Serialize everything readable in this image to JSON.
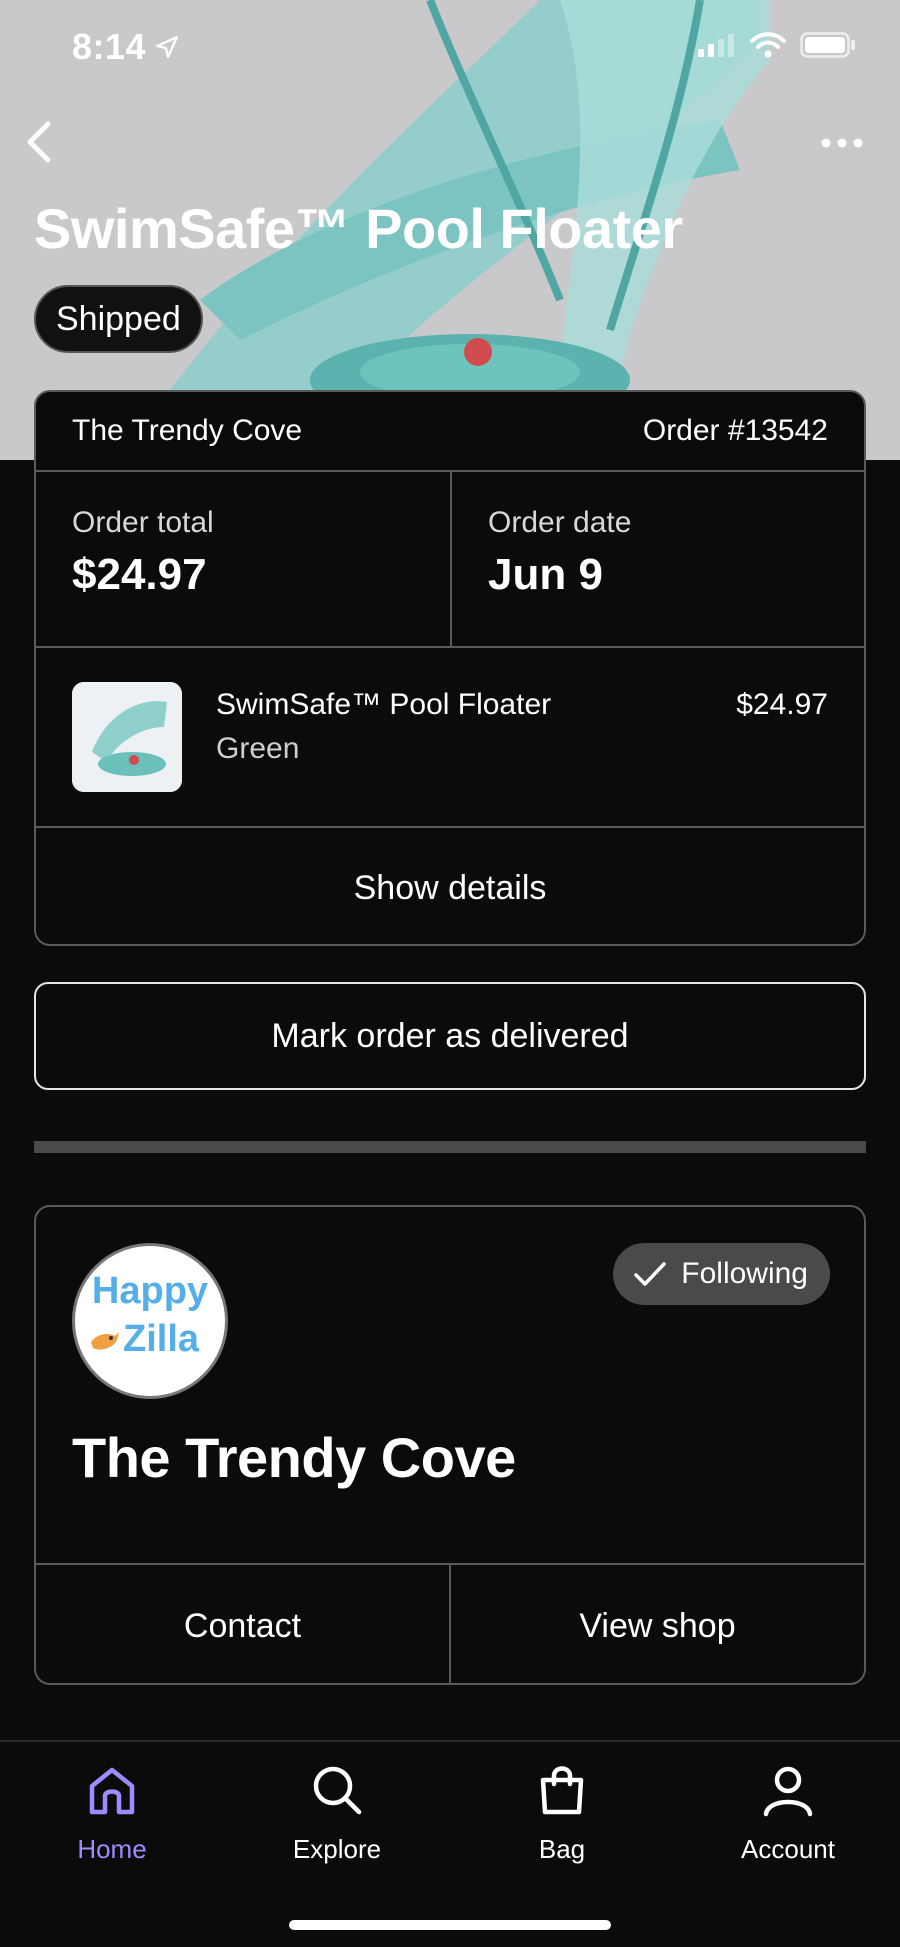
{
  "status_bar": {
    "time": "8:14"
  },
  "header": {
    "title": "SwimSafe™ Pool Floater",
    "status_badge": "Shipped"
  },
  "order": {
    "shop_name": "The Trendy Cove",
    "order_number": "Order #13542",
    "total_label": "Order total",
    "total_value": "$24.97",
    "date_label": "Order date",
    "date_value": "Jun 9",
    "item": {
      "name": "SwimSafe™ Pool Floater",
      "variant": "Green",
      "price": "$24.97"
    },
    "show_details": "Show details"
  },
  "mark_delivered": "Mark order as delivered",
  "shop": {
    "logo_line1": "Happy",
    "logo_line2": "Zilla",
    "follow_label": "Following",
    "name": "The Trendy Cove",
    "contact": "Contact",
    "view_shop": "View shop"
  },
  "tabs": [
    {
      "label": "Home",
      "icon": "home-icon",
      "active": true
    },
    {
      "label": "Explore",
      "icon": "search-icon",
      "active": false
    },
    {
      "label": "Bag",
      "icon": "bag-icon",
      "active": false
    },
    {
      "label": "Account",
      "icon": "account-icon",
      "active": false
    }
  ],
  "colors": {
    "accent": "#9b8cff",
    "background": "#0b0b0b",
    "product_teal": "#7fd3d0"
  }
}
